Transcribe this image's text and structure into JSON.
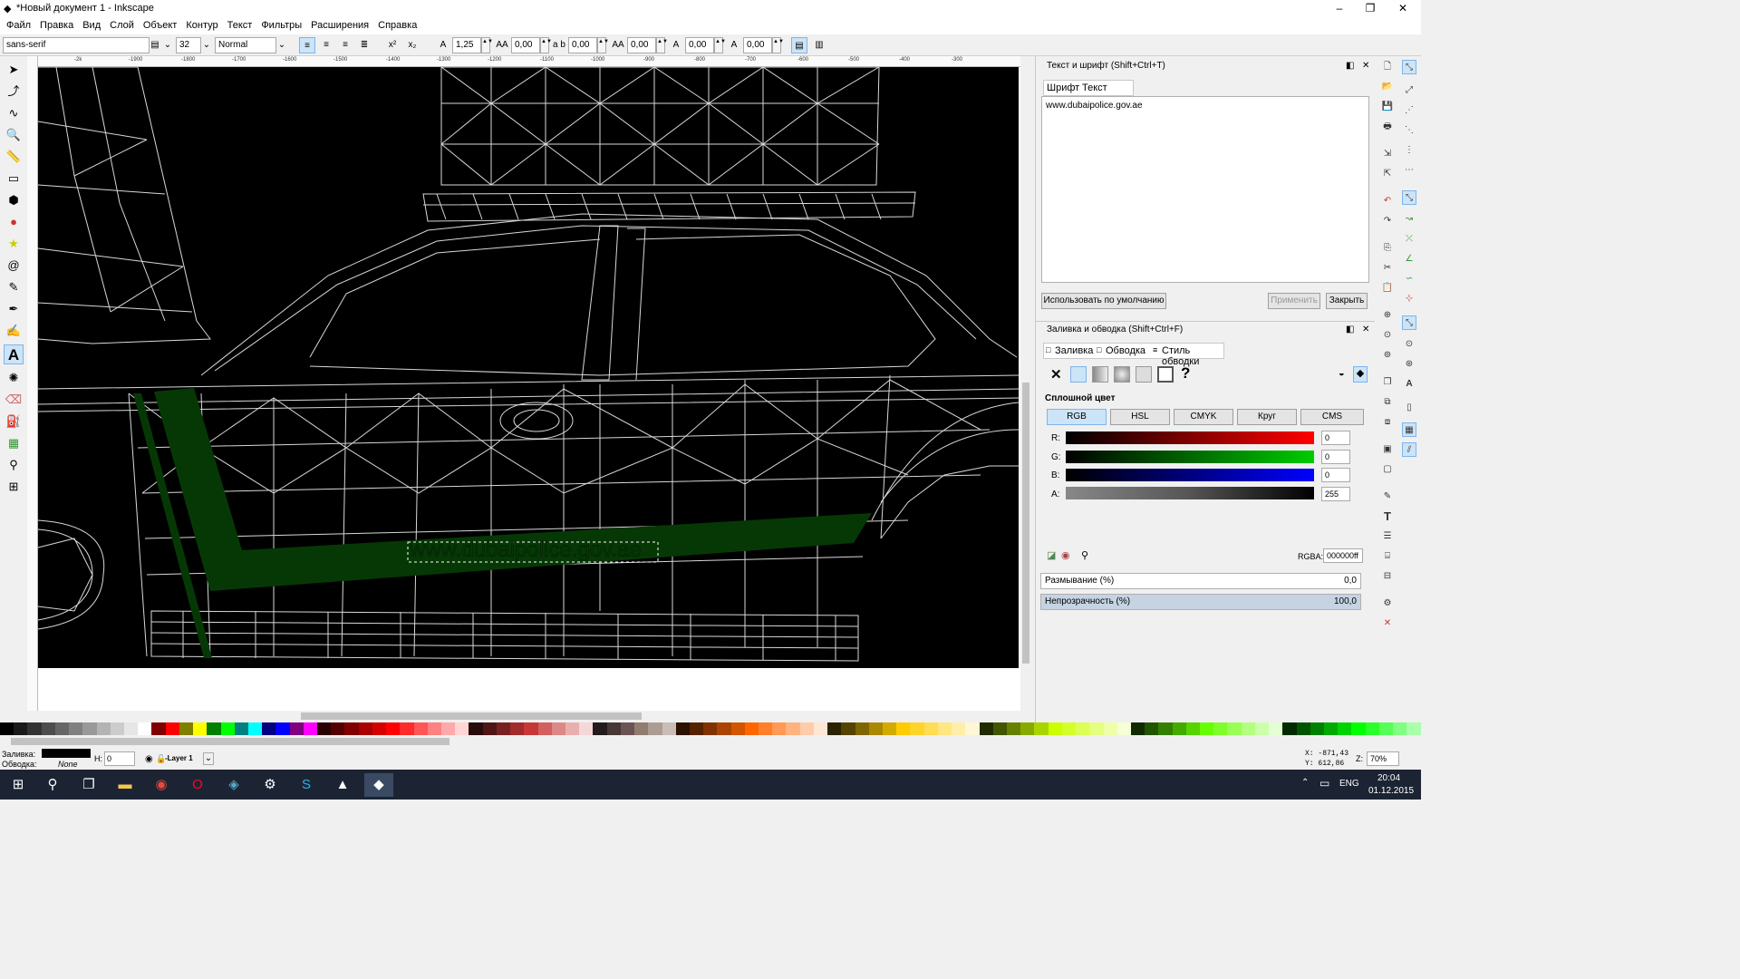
{
  "window": {
    "title": "*Новый документ 1 - Inkscape",
    "min": "–",
    "max": "❐",
    "close": "✕"
  },
  "menu": [
    "Файл",
    "Правка",
    "Вид",
    "Слой",
    "Объект",
    "Контур",
    "Текст",
    "Фильтры",
    "Расширения",
    "Справка"
  ],
  "text_toolbar": {
    "font_family": "sans-serif",
    "font_size": "32",
    "font_style": "Normal",
    "line_spacing": "1,25",
    "letter_spacing": "0,00",
    "word_spacing": "0,00",
    "kerning": "0,00",
    "vertical_shift": "0,00",
    "rotation": "0,00"
  },
  "ruler_labels": [
    "-2k",
    "-1900",
    "-1800",
    "-1700",
    "-1600",
    "-1500",
    "-1400",
    "-1300",
    "-1200",
    "-1100",
    "-1000",
    "-900",
    "-800",
    "-700",
    "-600",
    "-500",
    "-400",
    "-300"
  ],
  "canvas": {
    "text_object": "www.dubaipolice.gov.ae"
  },
  "text_font_dialog": {
    "title": "Текст и шрифт (Shift+Ctrl+T)",
    "tabs": [
      "Шрифт",
      "Текст"
    ],
    "content": "www.dubaipolice.gov.ae",
    "set_default": "Использовать по умолчанию",
    "apply": "Применить",
    "close": "Закрыть"
  },
  "fill_stroke_dialog": {
    "title": "Заливка и обводка (Shift+Ctrl+F)",
    "tabs": [
      "Заливка",
      "Обводка",
      "Стиль обводки"
    ],
    "paint_type": "Сплошной цвет",
    "unset_mark": "?",
    "modes": [
      "RGB",
      "HSL",
      "CMYK",
      "Круг",
      "CMS"
    ],
    "channels": [
      {
        "label": "R:",
        "value": "0"
      },
      {
        "label": "G:",
        "value": "0"
      },
      {
        "label": "B:",
        "value": "0"
      },
      {
        "label": "A:",
        "value": "255"
      }
    ],
    "rgba_label": "RGBA:",
    "rgba_value": "000000ff",
    "blur_label": "Размывание (%)",
    "blur_value": "0,0",
    "opacity_label": "Непрозрачность (%)",
    "opacity_value": "100,0"
  },
  "statusbar": {
    "fill_label": "Заливка:",
    "stroke_label": "Обводка:",
    "stroke_value": "None",
    "h_label": "H:",
    "h_value": "0",
    "layer": "-Layer 1",
    "x_coord": "X: -871,43",
    "y_coord": "Y: 612,86",
    "zoom_label": "Z:",
    "zoom_value": "70%"
  },
  "taskbar": {
    "lang": "ENG",
    "time": "20:04",
    "date": "01.12.2015"
  },
  "colors": {
    "accent": "#cce4f7",
    "fill_green": "#063806",
    "canvas_black": "#000000"
  }
}
